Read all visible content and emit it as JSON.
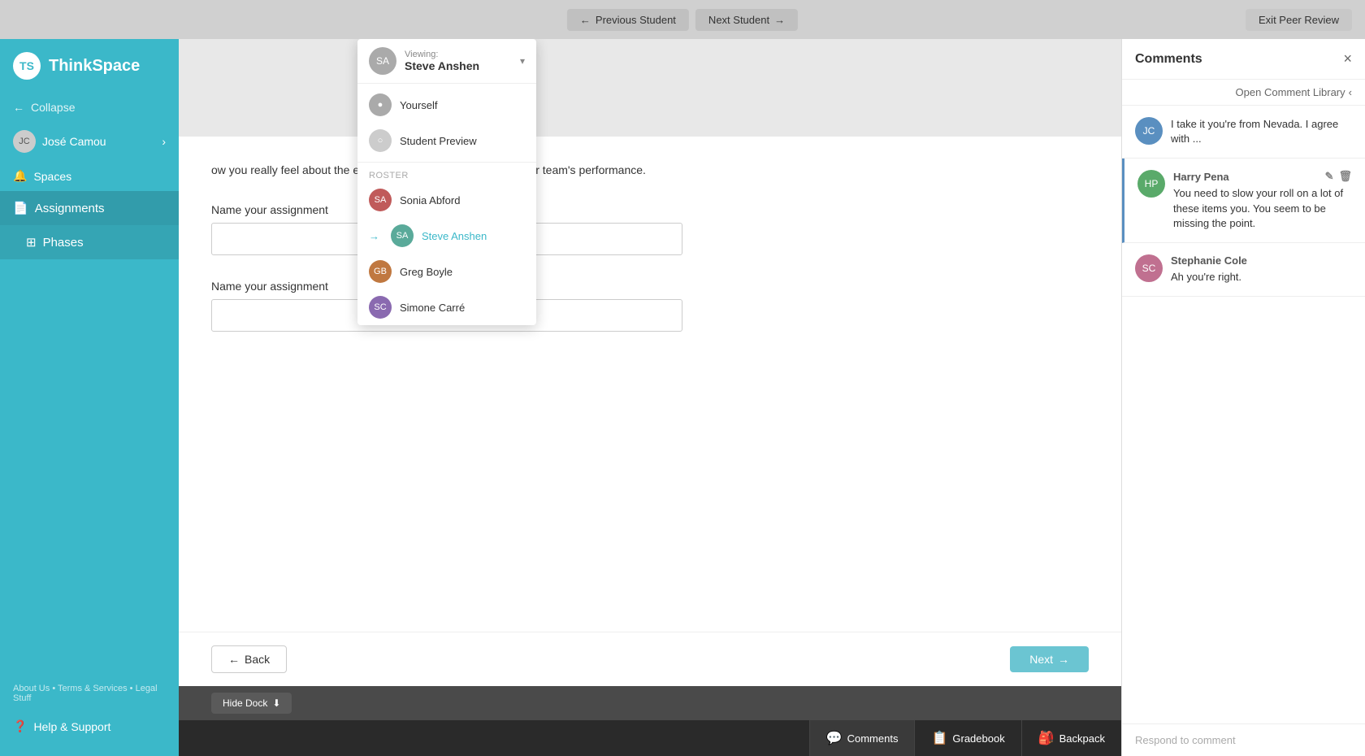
{
  "app": {
    "name": "ThinkSpace",
    "logo_text": "TS"
  },
  "topbar": {
    "previous_student": "Previous Student",
    "next_student": "Next Student",
    "exit_peer_review": "Exit Peer Review"
  },
  "sidebar": {
    "collapse_label": "Collapse",
    "user_name": "José Camou",
    "spaces_label": "Spaces",
    "assignments_label": "Assignments",
    "phases_label": "Phases",
    "help_label": "Help & Support",
    "links": [
      "About Us",
      "Terms & Services",
      "Legal Stuff"
    ]
  },
  "viewing_dropdown": {
    "label": "Viewing:",
    "current_name": "Steve Anshen",
    "options_special": [
      {
        "name": "Yourself"
      },
      {
        "name": "Student Preview"
      }
    ],
    "roster_label": "Roster",
    "roster_items": [
      {
        "name": "Sonia Abford",
        "color": "red"
      },
      {
        "name": "Steve Anshen",
        "color": "teal",
        "active": true
      },
      {
        "name": "Greg Boyle",
        "color": "orange"
      },
      {
        "name": "Simone Carré",
        "color": "purple"
      }
    ]
  },
  "content": {
    "question_text": "ow you really feel about the extent to which Owen Wheeler r your team's performance.",
    "field1_label": "Name your assignment",
    "field1_placeholder": "",
    "field2_label": "Name your assignment",
    "field2_placeholder": "",
    "back_label": "Back",
    "next_label": "Next",
    "hide_dock_label": "Hide Dock"
  },
  "comments": {
    "title": "Comments",
    "open_library": "Open Comment Library",
    "items": [
      {
        "id": 1,
        "author": "",
        "text": "I take it you're from Nevada. I agree with ...",
        "avatar_color": "blue",
        "avatar_initials": "JC"
      },
      {
        "id": 2,
        "author": "Harry Pena",
        "text": "You need to slow your roll on a lot of these items you. You seem to be missing the point.",
        "avatar_color": "green",
        "avatar_initials": "HP",
        "has_actions": true,
        "highlighted": true
      },
      {
        "id": 3,
        "author": "Stephanie Cole",
        "text": "Ah you're right.",
        "avatar_color": "pink",
        "avatar_initials": "SC"
      }
    ],
    "respond_placeholder": "Respond to comment"
  },
  "bottom_tabs": [
    {
      "label": "Comments",
      "icon": "💬",
      "active": true
    },
    {
      "label": "Gradebook",
      "icon": "📋",
      "active": false
    },
    {
      "label": "Backpack",
      "icon": "🎒",
      "active": false
    }
  ]
}
